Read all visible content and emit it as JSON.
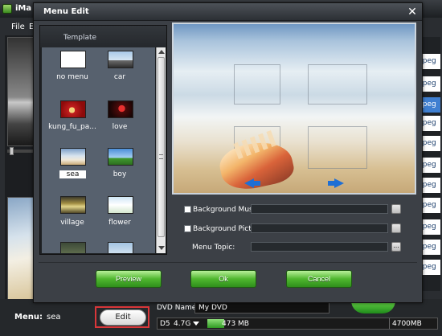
{
  "app": {
    "title": "iMa",
    "menu": [
      "File",
      "Ed"
    ],
    "right_list": [
      "mpeg",
      "mpeg",
      "mpeg",
      "mpeg",
      "mpeg",
      "mpeg",
      "mpeg",
      "mpeg",
      "mpeg",
      "mpeg",
      "mpeg"
    ],
    "menu_label": "Menu:",
    "menu_value": "sea",
    "edit_label": "Edit",
    "dvd_name_label": "DVD Name:",
    "dvd_name_value": "My DVD",
    "disc_type": "D5",
    "disc_size": "4.7G",
    "usage": "473 MB",
    "usage_fraction": 0.1,
    "capacity": "4700MB"
  },
  "dialog": {
    "title": "Menu Edit",
    "close_glyph": "✕",
    "template_header": "Template",
    "templates": [
      {
        "label": "no menu"
      },
      {
        "label": "car"
      },
      {
        "label": "kung_fu_pa..."
      },
      {
        "label": "love"
      },
      {
        "label": "sea"
      },
      {
        "label": "boy"
      },
      {
        "label": "village"
      },
      {
        "label": "flower"
      },
      {
        "label": ""
      },
      {
        "label": ""
      }
    ],
    "selected_template": "sea",
    "background_music_label": "Background Music:",
    "background_picture_label": "Background Picture:",
    "menu_topic_label": "Menu Topic:",
    "browse_glyph": "...",
    "preview_label": "Preview",
    "ok_label": "Ok",
    "cancel_label": "Cancel"
  },
  "colors": {
    "accent_green": "#4fb72e",
    "highlight_red": "#d9373a",
    "selection_blue": "#3f7fd1",
    "nav_arrow_blue": "#1f6fd4"
  },
  "icons": [
    "app-icon",
    "close-icon",
    "scroll-up-icon",
    "scroll-down-icon",
    "arrow-left-icon",
    "arrow-right-icon",
    "dropdown-icon"
  ]
}
